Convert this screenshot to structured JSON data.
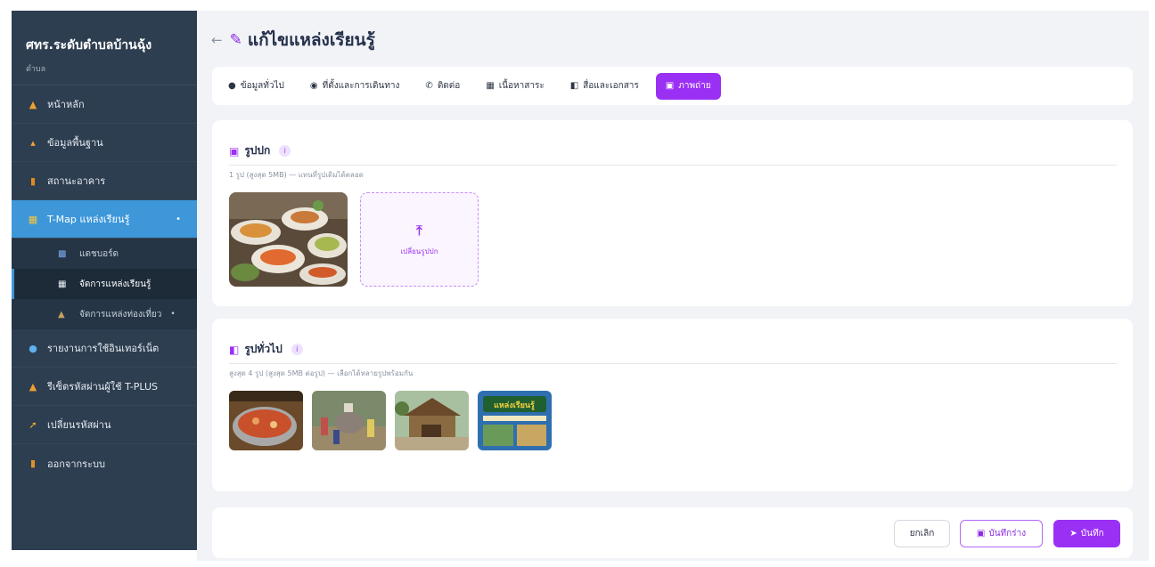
{
  "sidebar": {
    "title": "ศทร.ระดับตำบลบ้านฉุ้ง",
    "subtitle": "ตำบล",
    "items": [
      {
        "label": "หน้าหลัก",
        "icon": "home-icon"
      },
      {
        "label": "ข้อมูลพื้นฐาน",
        "icon": "house-icon"
      },
      {
        "label": "สถานะอาคาร",
        "icon": "building-icon"
      },
      {
        "label": "T-Map แหล่งเรียนรู้",
        "icon": "map-icon"
      },
      {
        "label": "รายงานการใช้อินเทอร์เน็ต",
        "icon": "globe-icon"
      },
      {
        "label": "รีเซ็ตรหัสผ่านผู้ใช้ T-PLUS",
        "icon": "user-lock-icon"
      },
      {
        "label": "เปลี่ยนรหัสผ่าน",
        "icon": "key-icon"
      },
      {
        "label": "ออกจากระบบ",
        "icon": "door-icon"
      }
    ],
    "submenu": [
      {
        "label": "แดชบอร์ด",
        "icon": "chart-icon"
      },
      {
        "label": "จัดการแหล่งเรียนรู้",
        "icon": "book-icon"
      },
      {
        "label": "จัดการแหล่งท่องเที่ยว",
        "icon": "landmark-icon"
      }
    ]
  },
  "header": {
    "back_icon": "arrow-left-icon",
    "title": "แก้ไขแหล่งเรียนรู้"
  },
  "tabs": [
    {
      "label": "ข้อมูลทั่วไป",
      "icon": "info-icon"
    },
    {
      "label": "ที่ตั้งและการเดินทาง",
      "icon": "pin-icon"
    },
    {
      "label": "ติดต่อ",
      "icon": "phone-icon"
    },
    {
      "label": "เนื้อหาสาระ",
      "icon": "book-open-icon"
    },
    {
      "label": "สื่อและเอกสาร",
      "icon": "media-icon"
    },
    {
      "label": "ภาพถ่าย",
      "icon": "photo-icon",
      "active": true
    }
  ],
  "cover": {
    "title": "รูปปก",
    "hint": "1 รูป (สูงสุด 5MB) — แทนที่รูปเดิมได้ตลอด",
    "upload_label": "เปลี่ยนรูปปก"
  },
  "gallery": {
    "title": "รูปทั่วไป",
    "hint": "สูงสุด 4 รูป (สูงสุด 5MB ต่อรูป) — เลือกได้หลายรูปพร้อมกัน",
    "poster_text": "แหล่งเรียนรู้"
  },
  "footer": {
    "cancel_label": "ยกเลิก",
    "draft_label": "บันทึกร่าง",
    "save_label": "บันทึก"
  },
  "colors": {
    "accent": "#9b30f5",
    "sidebar_bg": "#2d3e50",
    "sidebar_active": "#3d97d9"
  }
}
